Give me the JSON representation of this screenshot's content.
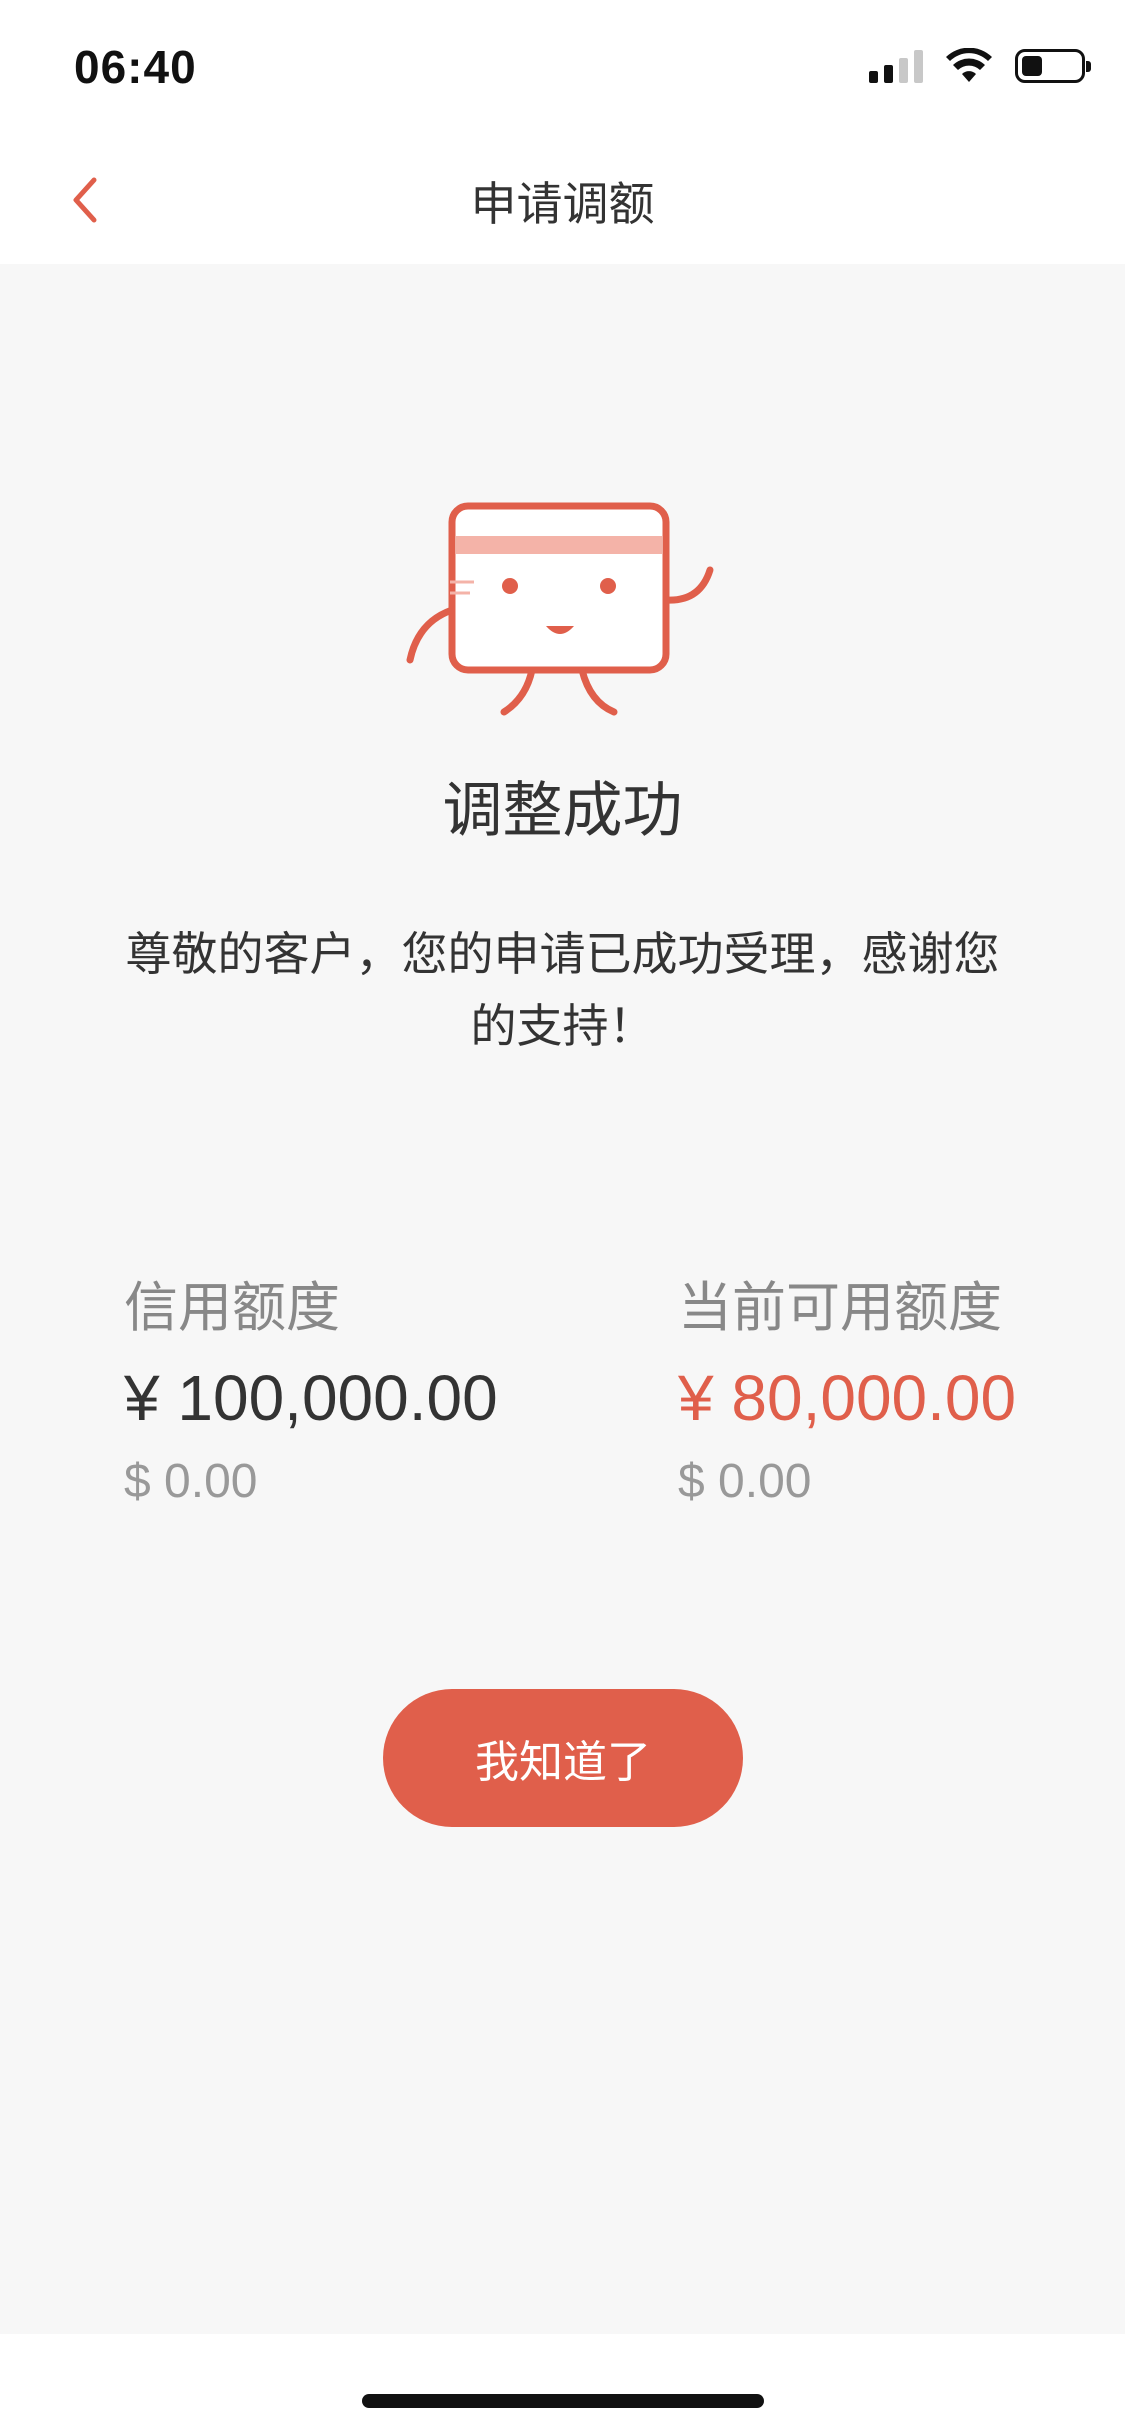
{
  "status_bar": {
    "time": "06:40",
    "icons": [
      "signal-icon",
      "wifi-icon",
      "battery-icon"
    ]
  },
  "nav": {
    "back_icon": "chevron-left-icon",
    "title": "申请调额"
  },
  "result": {
    "mascot_icon": "card-mascot-icon",
    "title": "调整成功",
    "message": "尊敬的客户，您的申请已成功受理，感谢您的支持！"
  },
  "limits": {
    "credit": {
      "label": "信用额度",
      "cny": "¥ 100,000.00",
      "usd": "$ 0.00"
    },
    "available": {
      "label": "当前可用额度",
      "cny": "¥ 80,000.00",
      "usd": "$ 0.00"
    }
  },
  "actions": {
    "ok_label": "我知道了"
  },
  "colors": {
    "accent": "#e05f4b",
    "background": "#f7f7f7",
    "text": "#333333",
    "muted": "#888888"
  }
}
